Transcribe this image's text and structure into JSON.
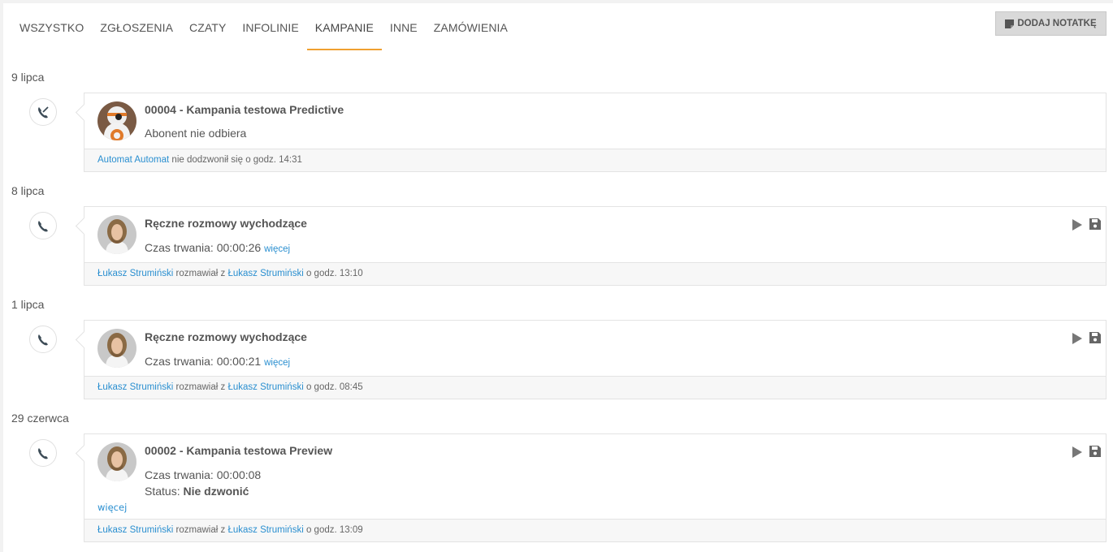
{
  "tabs": [
    {
      "label": "WSZYSTKO",
      "active": false
    },
    {
      "label": "ZGŁOSZENIA",
      "active": false
    },
    {
      "label": "CZATY",
      "active": false
    },
    {
      "label": "INFOLINIE",
      "active": false
    },
    {
      "label": "KAMPANIE",
      "active": true
    },
    {
      "label": "INNE",
      "active": false
    },
    {
      "label": "ZAMÓWIENIA",
      "active": false
    }
  ],
  "note_button": {
    "label": "DODAJ NOTATKĘ",
    "icon": "note-icon"
  },
  "accent_color": "#f0a030",
  "link_color": "#2a8fd0",
  "entries": [
    {
      "date": "9 lipca",
      "icon": "missed-call-icon",
      "avatar": "robot-avatar",
      "title": "00004 - Kampania testowa Predictive",
      "line1": "Abonent nie odbiera",
      "footer": {
        "user": "Automat Automat",
        "text": "nie dodzwonił się o godz. 14:31"
      }
    },
    {
      "date": "8 lipca",
      "icon": "phone-icon",
      "avatar": "user-avatar",
      "title": "Ręczne rozmowy wychodzące",
      "line1": "Czas trwania: 00:00:26",
      "more": "więcej",
      "footer": {
        "user": "Łukasz Strumiński",
        "mid": "rozmawiał z",
        "user2": "Łukasz Strumiński",
        "time": "o godz. 13:10"
      }
    },
    {
      "date": "1 lipca",
      "icon": "phone-icon",
      "avatar": "user-avatar",
      "title": "Ręczne rozmowy wychodzące",
      "line1": "Czas trwania: 00:00:21",
      "more": "więcej",
      "footer": {
        "user": "Łukasz Strumiński",
        "mid": "rozmawiał z",
        "user2": "Łukasz Strumiński",
        "time": "o godz. 08:45"
      }
    },
    {
      "date": "29 czerwca",
      "icon": "phone-icon",
      "avatar": "user-avatar",
      "title": "00002 - Kampania testowa Preview",
      "line1": "Czas trwania: 00:00:08",
      "status_label": "Status:",
      "status_value": "Nie dzwonić",
      "more": "więcej",
      "footer": {
        "user": "Łukasz Strumiński",
        "mid": "rozmawiał z",
        "user2": "Łukasz Strumiński",
        "time": "o godz. 13:09"
      }
    }
  ]
}
